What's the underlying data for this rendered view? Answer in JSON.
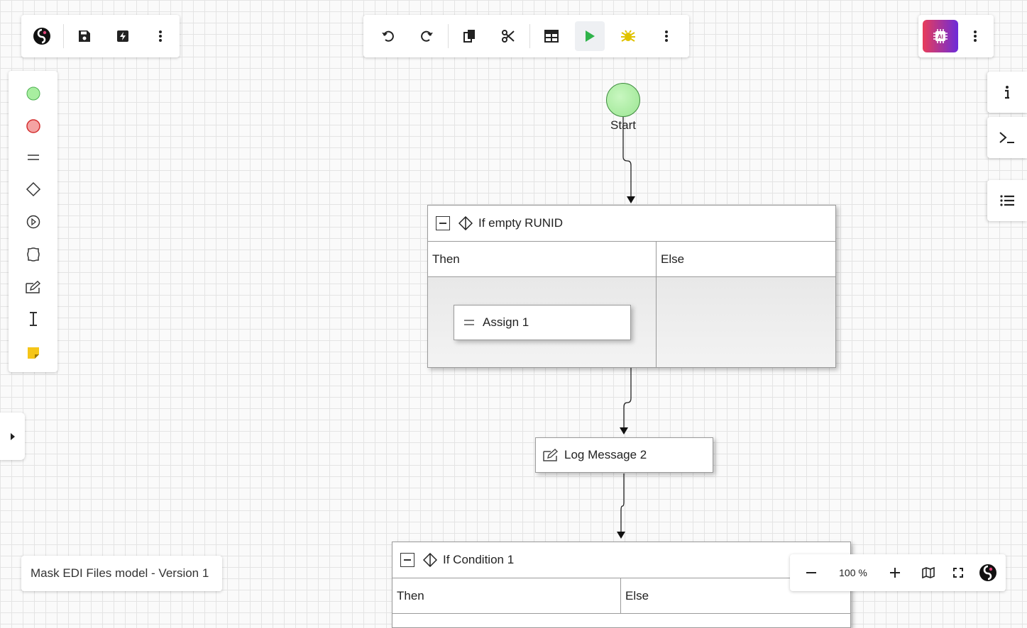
{
  "left_toolbar": {
    "icons": [
      "app-logo-icon",
      "save-icon",
      "publish-icon",
      "more-vert-icon"
    ]
  },
  "center_toolbar": {
    "icons": [
      "undo-icon",
      "redo-icon",
      "copy-icon",
      "cut-icon",
      "table-icon",
      "run-icon",
      "debug-icon",
      "more-vert-icon"
    ]
  },
  "right_toolbar": {
    "icons": [
      "ai-assistant-icon",
      "more-vert-icon"
    ],
    "ai_label": "AI"
  },
  "palette": {
    "items": [
      "start-node-icon",
      "end-node-icon",
      "assign-icon",
      "condition-icon",
      "call-subflow-icon",
      "loop-icon",
      "log-message-icon",
      "text-cursor-icon",
      "sticky-note-icon"
    ]
  },
  "side_panel": {
    "buttons": [
      "info-icon",
      "terminal-icon",
      "list-icon"
    ]
  },
  "canvas": {
    "start_label": "Start",
    "condition1": {
      "title": "If empty RUNID",
      "then": "Then",
      "else": "Else",
      "assign": "Assign 1"
    },
    "log": {
      "label": "Log Message 2"
    },
    "condition2": {
      "title": "If Condition 1",
      "then": "Then",
      "else": "Else"
    }
  },
  "model_title": "Mask EDI Files model - Version 1",
  "zoom": {
    "value": "100 %"
  },
  "colors": {
    "run": "#2fb34a",
    "debug": "#e0c200",
    "start": "#a8eea0",
    "end": "#f4a3a3",
    "ai_gradient_start": "#e83d5a",
    "ai_gradient_end": "#6c2bd9"
  }
}
